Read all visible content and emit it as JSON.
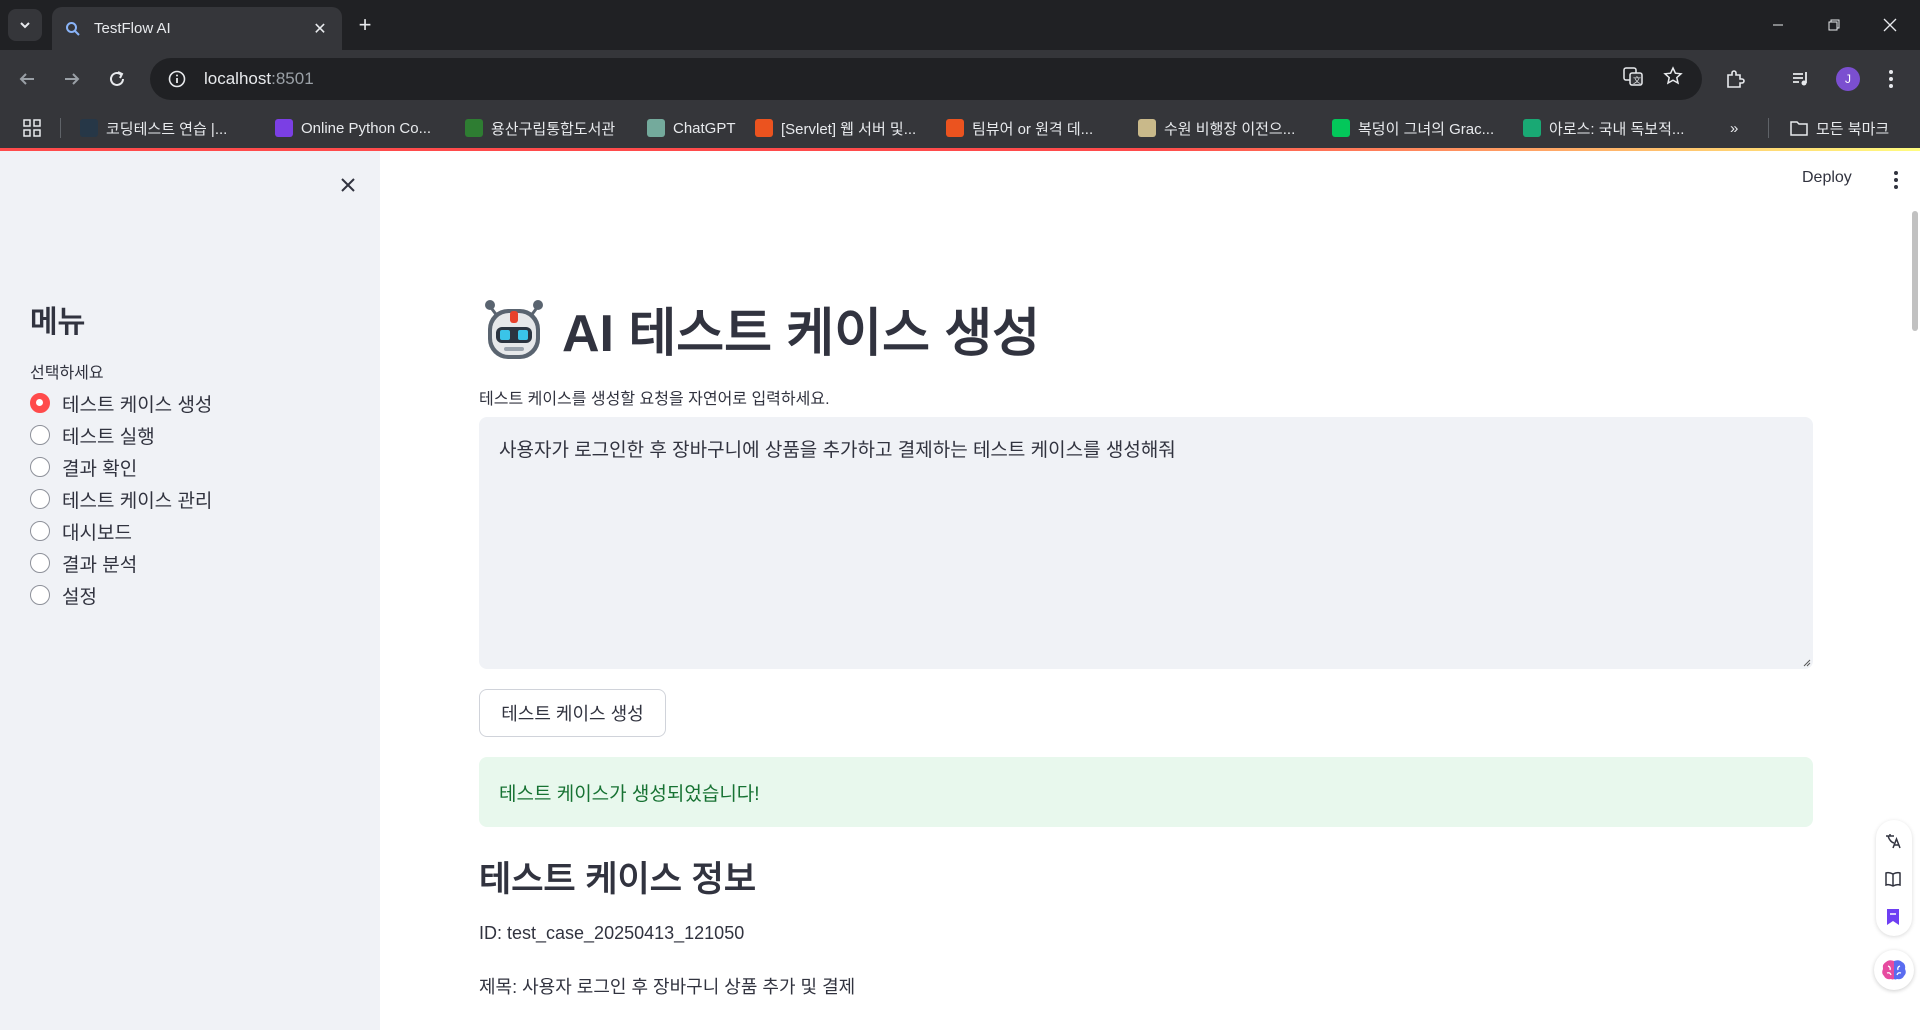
{
  "browser": {
    "tab_title": "TestFlow AI",
    "url_host": "localhost",
    "url_port": ":8501",
    "bookmarks": [
      {
        "label": "코딩테스트 연습 |...",
        "icon": "programmers-icon",
        "color": "#263747"
      },
      {
        "label": "Online Python Co...",
        "icon": "python-editor-icon",
        "color": "#7b3fe4"
      },
      {
        "label": "용산구립통합도서관",
        "icon": "library-icon",
        "color": "#2e7d32"
      },
      {
        "label": "ChatGPT",
        "icon": "chatgpt-icon",
        "color": "#74aa9c"
      },
      {
        "label": "[Servlet] 웹 서버 및...",
        "icon": "tistory-icon",
        "color": "#eb531f"
      },
      {
        "label": "팀뷰어 or 원격 데...",
        "icon": "tistory-icon",
        "color": "#eb531f"
      },
      {
        "label": "수원 비행장 이전으...",
        "icon": "document-icon",
        "color": "#c9b98a"
      },
      {
        "label": "복덩이 그녀의 Grac...",
        "icon": "blog-icon",
        "color": "#03c75a"
      },
      {
        "label": "아로스: 국내 독보적...",
        "icon": "aros-icon",
        "color": "#19a974"
      }
    ],
    "all_bookmarks_label": "모든 북마크",
    "avatar_initial": "J"
  },
  "sidebar": {
    "title": "메뉴",
    "radio_label": "선택하세요",
    "options": [
      {
        "label": "테스트 케이스 생성",
        "checked": true
      },
      {
        "label": "테스트 실행",
        "checked": false
      },
      {
        "label": "결과 확인",
        "checked": false
      },
      {
        "label": "테스트 케이스 관리",
        "checked": false
      },
      {
        "label": "대시보드",
        "checked": false
      },
      {
        "label": "결과 분석",
        "checked": false
      },
      {
        "label": "설정",
        "checked": false
      }
    ]
  },
  "header": {
    "deploy_label": "Deploy"
  },
  "main": {
    "title": "AI 테스트 케이스 생성",
    "textarea_label": "테스트 케이스를 생성할 요청을 자연어로 입력하세요.",
    "textarea_value": "사용자가 로그인한 후 장바구니에 상품을 추가하고 결제하는 테스트 케이스를 생성해줘",
    "generate_button": "테스트 케이스 생성",
    "success_message": "테스트 케이스가 생성되었습니다!",
    "section_title": "테스트 케이스 정보",
    "id_line": "ID: test_case_20250413_121050",
    "title_line": "제목: 사용자 로그인 후 장바구니 상품 추가 및 결제"
  },
  "colors": {
    "accent": "#ff4b4b",
    "sidebar_bg": "#f0f2f6",
    "success_bg": "#e8f8ed",
    "success_text": "#177233",
    "chrome_dark": "#202124",
    "chrome_mid": "#35363a"
  }
}
